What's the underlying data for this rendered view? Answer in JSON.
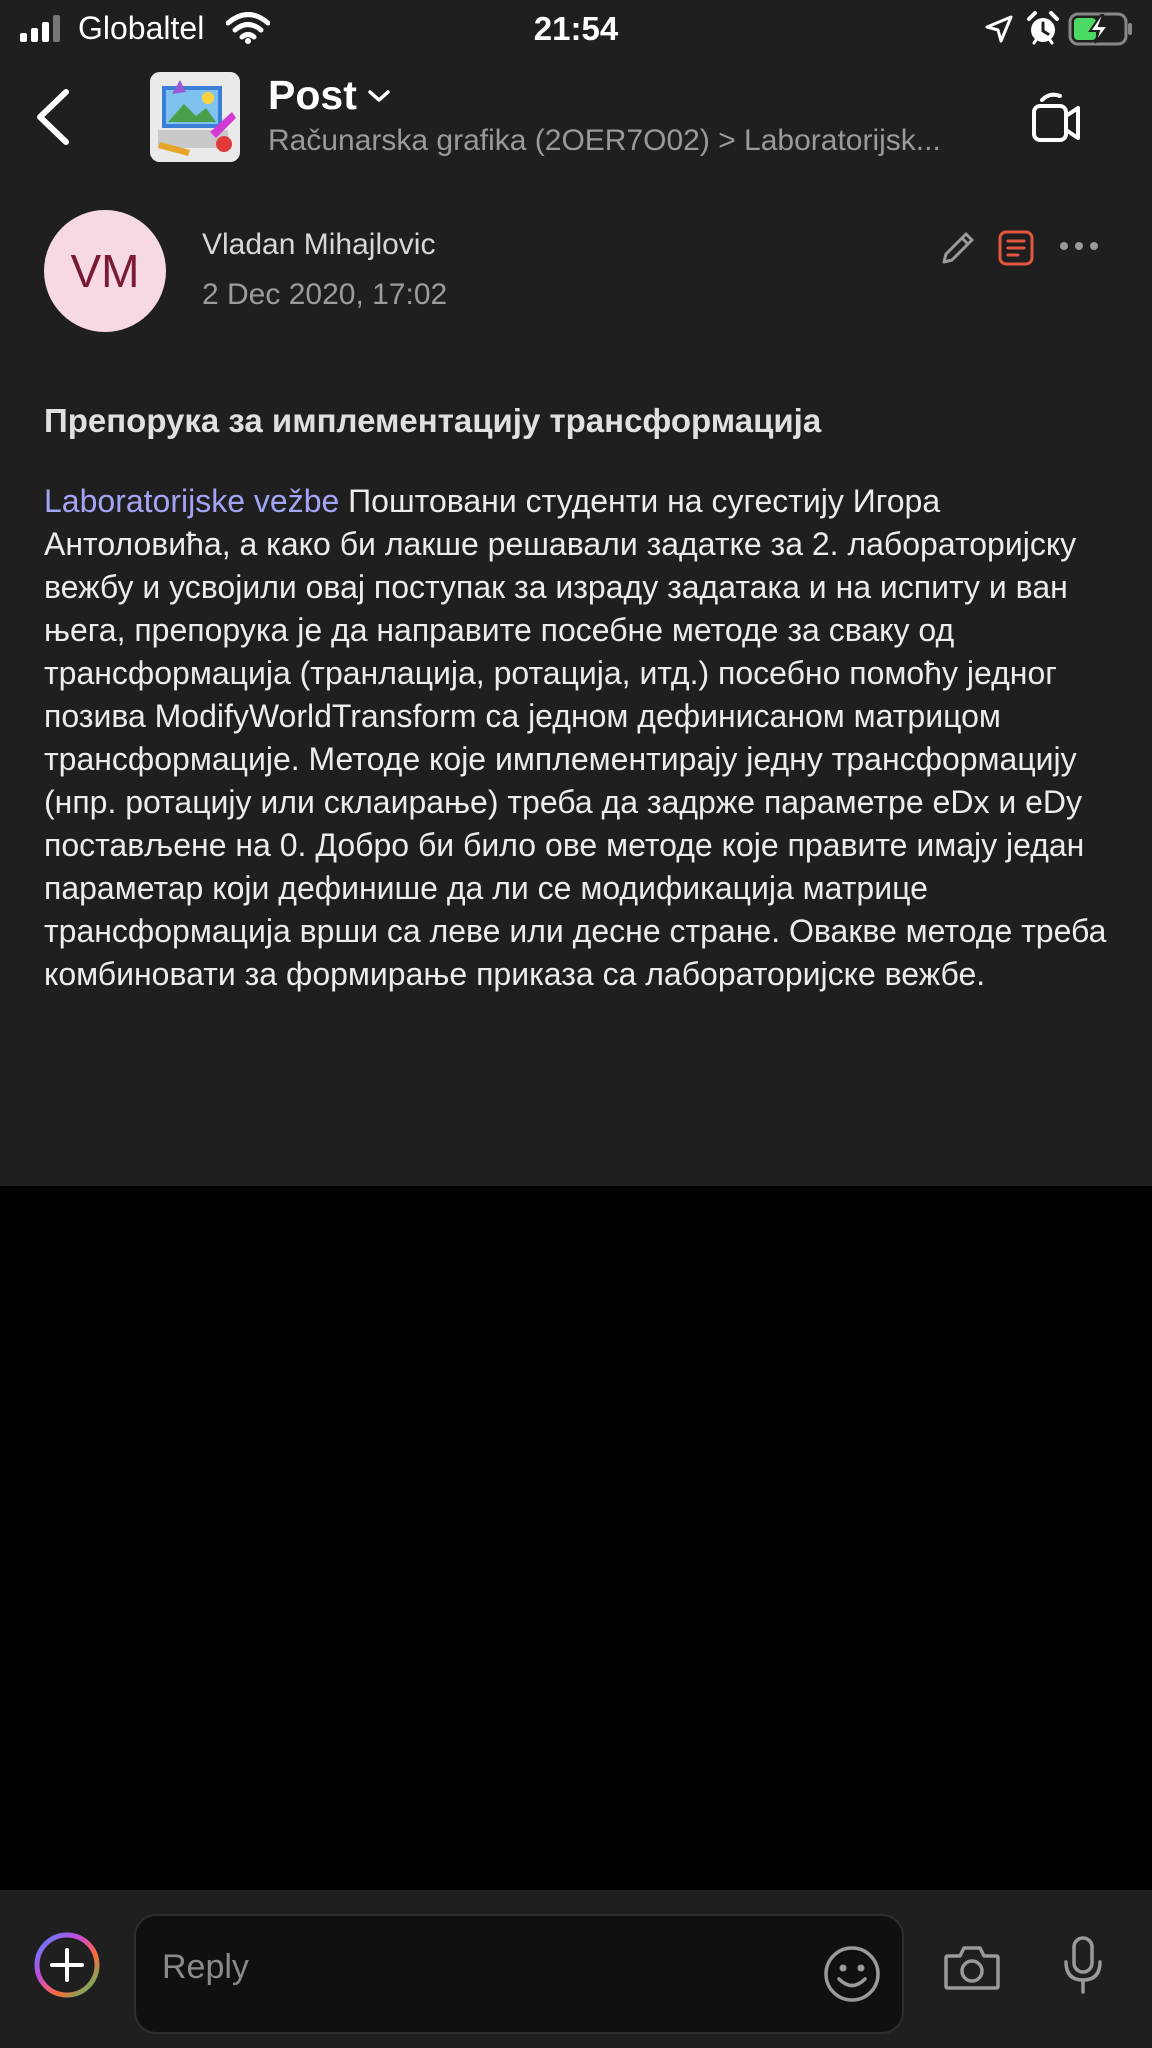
{
  "status_bar": {
    "carrier": "Globaltel",
    "time": "21:54",
    "icons": [
      "signal-icon",
      "wifi-icon",
      "location-icon",
      "alarm-icon",
      "battery-charging-icon"
    ]
  },
  "header": {
    "title": "Post",
    "breadcrumb": "Računarska grafika (2OER7O02) > Laboratorijsk...",
    "icons": [
      "back-icon",
      "chevron-down-icon",
      "video-call-icon"
    ]
  },
  "post": {
    "avatar_initials": "VM",
    "author": "Vladan Mihajlovic",
    "timestamp": "2 Dec 2020, 17:02",
    "heading": "Препорука за имплементацију трансформација",
    "tag": "Laboratorijske vežbe",
    "body": " Поштовани студенти на сугестију Игора Антоловића, а како би лакше решавали задатке за 2. лабораторијску вежбу и усвојили овај поступак за израду задатака и на испиту и ван њега, препорука је да направите посебне методе за сваку од трансформација (транлација, ротација, итд.) посебно помоћу једног позива ModifyWorldTransform са једном дефинисаном матрицом трансформације. Методе које имплементирају једну трансформацију (нпр. ротацију или склаирање) треба да задрже параметре eDx и eDy постављене на 0. Добро би било ове методе које правите имају један параметар који дефинише да ли се модификација матрице трансформација врши са леве или десне стране. Овакве методе треба комбиновати за формирање приказа са лабораторијске вежбе.",
    "actions": [
      "edit-icon",
      "task-icon",
      "more-icon"
    ]
  },
  "reply": {
    "placeholder": "Reply",
    "icons": [
      "plus-icon",
      "emoji-icon",
      "camera-icon",
      "microphone-icon"
    ]
  },
  "colors": {
    "surface": "#1f1f1f",
    "background": "#000000",
    "link": "#a3a4f5",
    "avatar_bg": "#f7d9e4",
    "avatar_text": "#7a1b33",
    "task_accent": "#e2573f",
    "battery_green": "#4cd964"
  }
}
